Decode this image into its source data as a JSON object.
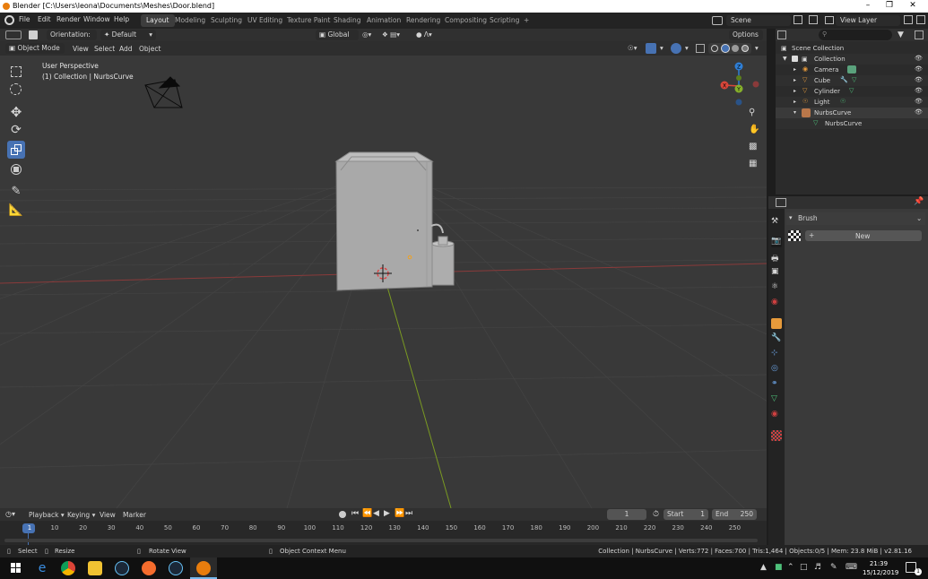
{
  "window": {
    "title": "Blender [C:\\Users\\leona\\Documents\\Meshes\\Door.blend]"
  },
  "menubar": {
    "items": [
      "File",
      "Edit",
      "Render",
      "Window",
      "Help"
    ],
    "workspaces": [
      "Layout",
      "Modeling",
      "Sculpting",
      "UV Editing",
      "Texture Paint",
      "Shading",
      "Animation",
      "Rendering",
      "Compositing",
      "Scripting"
    ],
    "active_workspace": "Layout",
    "add_tab": "+",
    "scene": "Scene",
    "view_layer": "View Layer"
  },
  "viewport_header": {
    "orientation_label": "Orientation:",
    "orientation_value": "Default",
    "transform_space": "Global",
    "options": "Options",
    "mode": "Object Mode",
    "menus": [
      "View",
      "Select",
      "Add",
      "Object"
    ]
  },
  "viewport": {
    "perspective": "User Perspective",
    "collection_info": "(1) Collection | NurbsCurve",
    "gizmo": {
      "x": "X",
      "y": "Y",
      "z": "Z"
    },
    "colors": {
      "x_axis": "#d9463a",
      "y_axis": "#86b02b",
      "z_axis": "#2f7fd6"
    }
  },
  "outliner": {
    "root": "Scene Collection",
    "collection": "Collection",
    "objects": [
      "Camera",
      "Cube",
      "Cylinder",
      "Light",
      "NurbsCurve"
    ],
    "child": "NurbsCurve"
  },
  "properties": {
    "brush_label": "Brush",
    "new_button": "New",
    "new_plus": "+"
  },
  "timeline": {
    "menus": [
      "Playback",
      "Keying",
      "View",
      "Marker"
    ],
    "current_frame": "1",
    "start_label": "Start",
    "start_value": "1",
    "end_label": "End",
    "end_value": "250",
    "ticks": [
      "1",
      "10",
      "20",
      "30",
      "40",
      "50",
      "60",
      "70",
      "80",
      "90",
      "100",
      "110",
      "120",
      "130",
      "140",
      "150",
      "160",
      "170",
      "180",
      "190",
      "200",
      "210",
      "220",
      "230",
      "240",
      "250"
    ]
  },
  "statusbar": {
    "select": "Select",
    "resize": "Resize",
    "rotate_view": "Rotate View",
    "context_menu": "Object Context Menu",
    "stats": "Collection | NurbsCurve | Verts:772 | Faces:700 | Tris:1,464 | Objects:0/5 | Mem: 23.8 MiB | v2.81.16"
  },
  "taskbar": {
    "time": "21:39",
    "date": "15/12/2019",
    "notification_count": "1"
  }
}
